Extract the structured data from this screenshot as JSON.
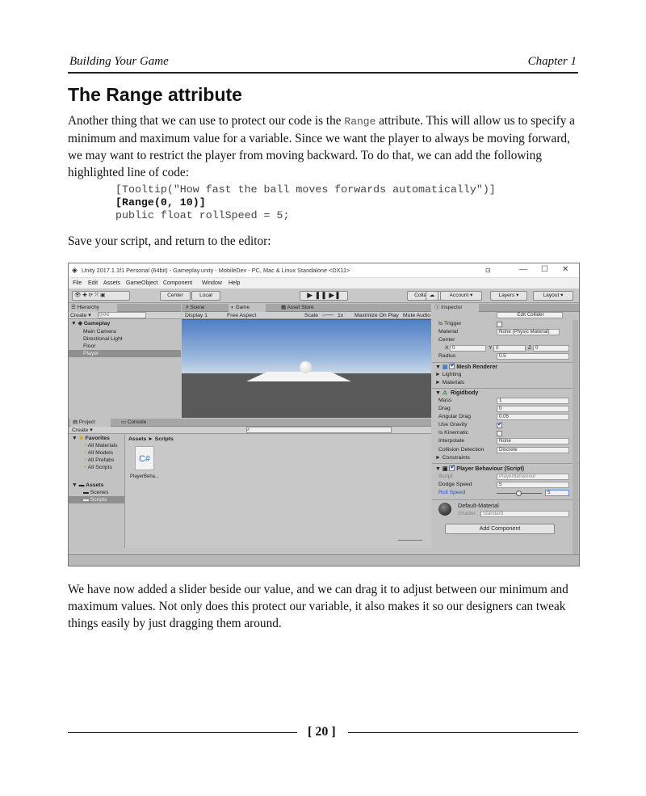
{
  "header": {
    "left": "Building Your Game",
    "right": "Chapter 1"
  },
  "section_title": "The Range attribute",
  "para1": {
    "pre": "Another thing that we can use to protect our code is the ",
    "code": "Range",
    "post": " attribute. This will allow us to specify a minimum and maximum value for a variable. Since we want the player to always be moving forward, we may want to restrict the player from moving backward. To do that, we can add the following highlighted line of code:"
  },
  "code": {
    "line1": "[Tooltip(\"How fast the ball moves forwards automatically\")]",
    "line2": "[Range(0, 10)]",
    "line3": "public float rollSpeed = 5;"
  },
  "para2": "Save your script, and return to the editor:",
  "unity": {
    "title": "Unity 2017.1.1f1 Personal (64bit) - Gameplay.unity - MobileDev - PC, Mac & Linux Standalone <DX11>",
    "menu": [
      "File",
      "Edit",
      "Assets",
      "GameObject",
      "Component",
      "Window",
      "Help"
    ],
    "toolbar": {
      "center": "Center",
      "local": "Local",
      "collab": "Collab ▾",
      "account": "Account ▾",
      "layers": "Layers ▾",
      "layout": "Layout ▾"
    },
    "hierarchy": {
      "tab": "Hierarchy",
      "create": "Create ▾",
      "search": "Q▾All",
      "scene": "Gameplay",
      "items": [
        "Main Camera",
        "Directional Light",
        "Floor",
        "Player"
      ]
    },
    "scene_tabs": {
      "scene": "Scene",
      "game": "Game",
      "store": "Asset Store"
    },
    "game_bar": {
      "display": "Display 1",
      "aspect": "Free Aspect",
      "scale": "Scale",
      "scale_val": "1x",
      "maximize": "Maximize On Play",
      "mute": "Mute Audio"
    },
    "project": {
      "tab": "Project",
      "console": "Console",
      "create": "Create ▾",
      "favorites": "Favorites",
      "fav_items": [
        "All Materials",
        "All Models",
        "All Prefabs",
        "All Scripts"
      ],
      "assets": "Assets",
      "asset_items": [
        "Scenes",
        "Scripts"
      ],
      "breadcrumb": "Assets ► Scripts",
      "file": "PlayerBeha..."
    },
    "inspector": {
      "tab": "Inspector",
      "edit_collider": "Edit Collider",
      "is_trigger": "Is Trigger",
      "material": "Material",
      "material_val": "None (Physic Material)",
      "center": "Center",
      "cx": "0",
      "cy": "0",
      "cz": "0",
      "radius": "Radius",
      "radius_val": "0.5",
      "mesh_renderer": "Mesh Renderer",
      "lighting": "Lighting",
      "materials": "Materials",
      "rigidbody": "Rigidbody",
      "mass": "Mass",
      "mass_val": "1",
      "drag": "Drag",
      "drag_val": "0",
      "angular_drag": "Angular Drag",
      "angular_drag_val": "0.05",
      "use_gravity": "Use Gravity",
      "is_kinematic": "Is Kinematic",
      "interpolate": "Interpolate",
      "interpolate_val": "None",
      "collision": "Collision Detection",
      "collision_val": "Discrete",
      "constraints": "Constraints",
      "player_behaviour": "Player Behaviour (Script)",
      "script": "Script",
      "script_val": "PlayerBehaviour",
      "dodge_speed": "Dodge Speed",
      "dodge_val": "5",
      "roll_speed": "Roll Speed",
      "roll_val": "5",
      "default_material": "Default-Material",
      "shader": "Shader",
      "shader_val": "Standard",
      "add_component": "Add Component"
    }
  },
  "para3": "We have now added a slider beside our value, and we can drag it to adjust between our minimum and maximum values. Not only does this protect our variable, it also makes it so our designers can tweak things easily by just dragging them around.",
  "page_number": "[ 20 ]"
}
